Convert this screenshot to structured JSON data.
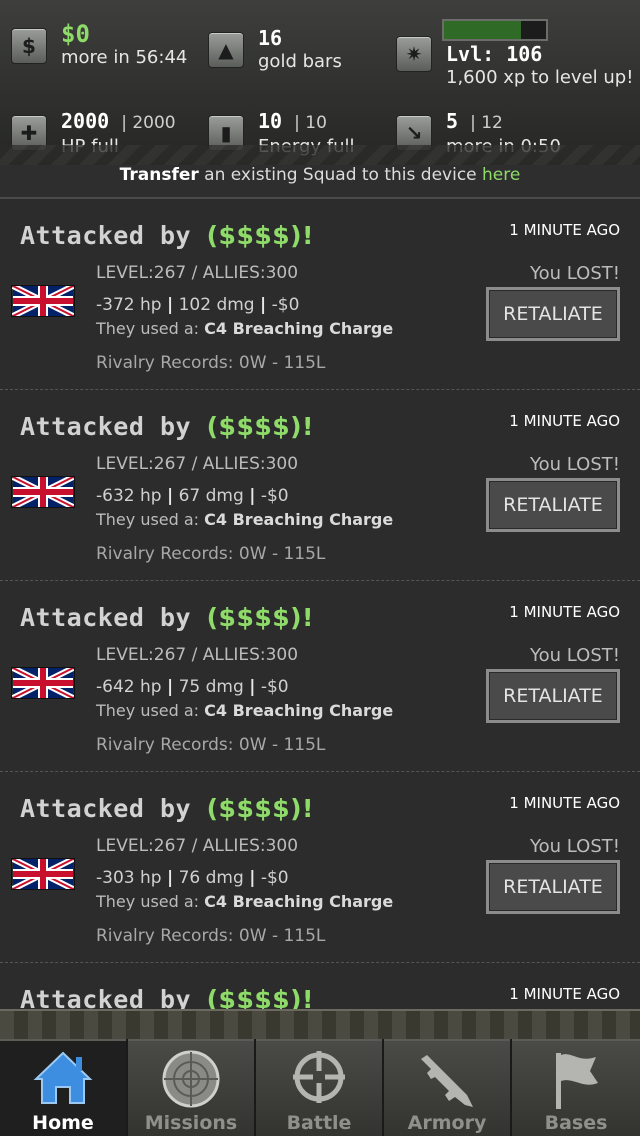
{
  "header": {
    "money": {
      "value": "$0",
      "sub": "more in 56:44",
      "icon": "money-icon"
    },
    "gold": {
      "value": "16",
      "sub": "gold bars",
      "icon": "gold-bars-icon"
    },
    "level": {
      "value": "Lvl: 106",
      "sub": "1,600 xp to level up!",
      "icon": "level-star-icon",
      "xp_progress": 0.75
    },
    "hp": {
      "value": "2000",
      "max": "| 2000",
      "sub": "HP full",
      "icon": "health-cross-icon"
    },
    "energy": {
      "value": "10",
      "max": "| 10",
      "sub": "Energy full",
      "icon": "energy-battery-icon"
    },
    "stamina": {
      "value": "5",
      "max": "| 12",
      "sub": "more in 0:50",
      "icon": "stamina-icon"
    }
  },
  "transfer": {
    "bold": "Transfer",
    "text": " an existing Squad to this device ",
    "link": "here"
  },
  "feed": [
    {
      "title": "Attacked by ",
      "name": "($$$$)!",
      "time": "1 MINUTE AGO",
      "level": "LEVEL:267 / ALLIES:300",
      "result": "You LOST!",
      "hp": "-372 hp",
      "dmg": "102 dmg",
      "money": "-$0",
      "used_label": "They used a: ",
      "used_item": "C4 Breaching Charge",
      "rivalry": "Rivalry Records:  0W - 115L",
      "button": "RETALIATE"
    },
    {
      "title": "Attacked by ",
      "name": "($$$$)!",
      "time": "1 MINUTE AGO",
      "level": "LEVEL:267 / ALLIES:300",
      "result": "You LOST!",
      "hp": "-632 hp",
      "dmg": "67 dmg",
      "money": "-$0",
      "used_label": "They used a: ",
      "used_item": "C4 Breaching Charge",
      "rivalry": "Rivalry Records:  0W - 115L",
      "button": "RETALIATE"
    },
    {
      "title": "Attacked by ",
      "name": "($$$$)!",
      "time": "1 MINUTE AGO",
      "level": "LEVEL:267 / ALLIES:300",
      "result": "You LOST!",
      "hp": "-642 hp",
      "dmg": "75 dmg",
      "money": "-$0",
      "used_label": "They used a: ",
      "used_item": "C4 Breaching Charge",
      "rivalry": "Rivalry Records:  0W - 115L",
      "button": "RETALIATE"
    },
    {
      "title": "Attacked by ",
      "name": "($$$$)!",
      "time": "1 MINUTE AGO",
      "level": "LEVEL:267 / ALLIES:300",
      "result": "You LOST!",
      "hp": "-303 hp",
      "dmg": "76 dmg",
      "money": "-$0",
      "used_label": "They used a: ",
      "used_item": "C4 Breaching Charge",
      "rivalry": "Rivalry Records:  0W - 115L",
      "button": "RETALIATE"
    },
    {
      "title": "Attacked by ",
      "name": "($$$$)!",
      "time": "1 MINUTE AGO"
    }
  ],
  "tabs": [
    {
      "label": "Home",
      "icon": "home-icon",
      "active": true
    },
    {
      "label": "Missions",
      "icon": "radar-icon"
    },
    {
      "label": "Battle",
      "icon": "crosshair-icon"
    },
    {
      "label": "Armory",
      "icon": "rifle-icon"
    },
    {
      "label": "Bases",
      "icon": "flag-icon"
    }
  ],
  "colors": {
    "accent_green": "#8fdb6a",
    "background": "#2c2c2c"
  }
}
